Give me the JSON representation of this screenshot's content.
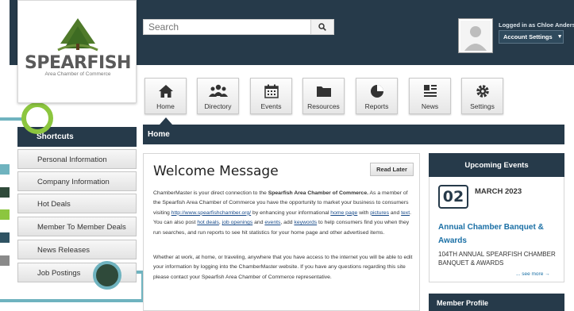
{
  "header": {
    "logo": {
      "name": "SPEARFISH",
      "subtitle": "Area Chamber of Commerce"
    },
    "search": {
      "placeholder": "Search",
      "button_icon": "search-icon"
    },
    "user": {
      "logged_in_text": "Logged in as Chloe Anderson",
      "account_settings_label": "Account Settings"
    }
  },
  "nav": {
    "items": [
      {
        "label": "Home",
        "icon": "home-icon"
      },
      {
        "label": "Directory",
        "icon": "people-icon"
      },
      {
        "label": "Events",
        "icon": "calendar-icon"
      },
      {
        "label": "Resources",
        "icon": "folder-icon"
      },
      {
        "label": "Reports",
        "icon": "pie-chart-icon"
      },
      {
        "label": "News",
        "icon": "news-icon"
      },
      {
        "label": "Settings",
        "icon": "gear-icon"
      }
    ]
  },
  "breadcrumb": {
    "title": "Home"
  },
  "sidebar": {
    "title": "Shortcuts",
    "items": [
      {
        "label": "Personal Information"
      },
      {
        "label": "Company Information"
      },
      {
        "label": "Hot Deals"
      },
      {
        "label": "Member To Member Deals"
      },
      {
        "label": "News Releases"
      },
      {
        "label": "Job Postings"
      }
    ]
  },
  "welcome": {
    "title": "Welcome Message",
    "read_later_label": "Read Later",
    "p1": {
      "a": "ChamberMaster is your direct connection to the ",
      "strong": "Spearfish Area Chamber of Commerce.",
      "b": " As a member of the Spearfish Area Chamber of Commerce you have the opportunity to market your business to consumers visiting ",
      "link_url": "http://www.spearfishchamber.org/",
      "c": " by enhancing your informational ",
      "link_home_page": "home page",
      "d": " with ",
      "link_pictures": "pictures",
      "e": " and ",
      "link_text": "text",
      "f": ". You can also post ",
      "link_hot_deals": "hot deals",
      "g": ", ",
      "link_job_openings": "job openings",
      "h": " and ",
      "link_events": "events",
      "i": ", add ",
      "link_keywords": "keywords",
      "j": " to help consumers find you when they run searches, and run reports to see hit statistics for your home page and other advertised items."
    },
    "p2": "Whether at work, at home, or traveling, anywhere that you have access to the internet you will be able to edit your information by logging into the ChamberMaster website. If you have any questions regarding this site please contact your Spearfish Area Chamber of Commerce representative."
  },
  "upcoming_events": {
    "title": "Upcoming Events",
    "day": "02",
    "month_year": "MARCH 2023",
    "event_title": "Annual Chamber Banquet & Awards",
    "event_desc": "104TH ANNUAL SPEARFISH CHAMBER BANQUET & AWARDS",
    "see_more": "... see more →"
  },
  "member_profile": {
    "title": "Member Profile"
  },
  "colors": {
    "header": "#263a4a",
    "accent_teal": "#6fb3bf",
    "accent_green": "#8cc63f",
    "accent_dark": "#2f4a3a",
    "accent_gray": "#8a8a8a",
    "link": "#1a4c8a"
  }
}
